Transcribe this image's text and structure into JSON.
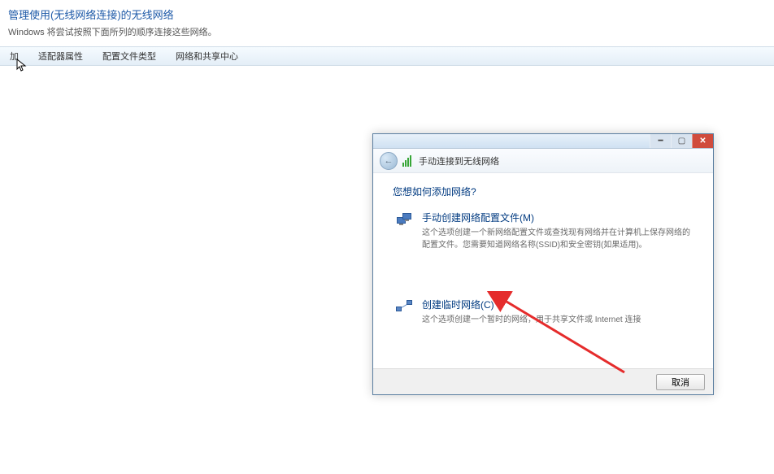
{
  "header": {
    "title": "管理使用(无线网络连接)的无线网络",
    "subtitle": "Windows 将尝试按照下面所列的顺序连接这些网络。"
  },
  "toolbar": {
    "add": "加",
    "adapter_props": "适配器属性",
    "profile_types": "配置文件类型",
    "network_center": "网络和共享中心"
  },
  "dialog": {
    "breadcrumb": "手动连接到无线网络",
    "question": "您想如何添加网络?",
    "options": [
      {
        "title": "手动创建网络配置文件(M)",
        "desc": "这个选项创建一个新网络配置文件或查找现有网络并在计算机上保存网络的配置文件。您需要知道网络名称(SSID)和安全密钥(如果适用)。"
      },
      {
        "title": "创建临时网络(C)",
        "desc": "这个选项创建一个暂时的网络，用于共享文件或 Internet 连接"
      }
    ],
    "cancel": "取消"
  }
}
